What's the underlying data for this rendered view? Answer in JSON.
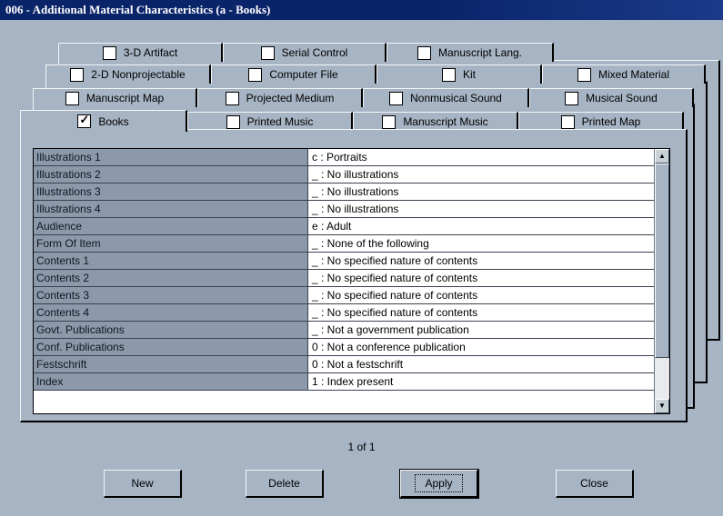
{
  "window": {
    "title": "006 - Additional Material Characteristics (a - Books)"
  },
  "tabs": {
    "row1": [
      {
        "label": "3-D Artifact",
        "checked": false
      },
      {
        "label": "Serial Control",
        "checked": false
      },
      {
        "label": "Manuscript Lang.",
        "checked": false
      }
    ],
    "row2": [
      {
        "label": "2-D Nonprojectable",
        "checked": false
      },
      {
        "label": "Computer File",
        "checked": false
      },
      {
        "label": "Kit",
        "checked": false
      },
      {
        "label": "Mixed Material",
        "checked": false
      }
    ],
    "row3": [
      {
        "label": "Manuscript Map",
        "checked": false
      },
      {
        "label": "Projected Medium",
        "checked": false
      },
      {
        "label": "Nonmusical Sound",
        "checked": false
      },
      {
        "label": "Musical Sound",
        "checked": false
      }
    ],
    "row4": [
      {
        "label": "Books",
        "checked": true,
        "active": true
      },
      {
        "label": "Printed Music",
        "checked": false
      },
      {
        "label": "Manuscript Music",
        "checked": false
      },
      {
        "label": "Printed Map",
        "checked": false
      }
    ]
  },
  "grid": {
    "rows": [
      {
        "label": "Illustrations 1",
        "value": "c : Portraits"
      },
      {
        "label": "Illustrations 2",
        "value": "_ : No illustrations"
      },
      {
        "label": "Illustrations 3",
        "value": "_ : No illustrations"
      },
      {
        "label": "Illustrations 4",
        "value": "_ : No illustrations"
      },
      {
        "label": "Audience",
        "value": "e : Adult"
      },
      {
        "label": "Form Of Item",
        "value": "_ : None of the following"
      },
      {
        "label": "Contents 1",
        "value": "_ : No specified nature of contents"
      },
      {
        "label": "Contents 2",
        "value": "_ : No specified nature of contents"
      },
      {
        "label": "Contents 3",
        "value": "_ : No specified nature of contents"
      },
      {
        "label": "Contents 4",
        "value": "_ : No specified nature of contents"
      },
      {
        "label": "Govt. Publications",
        "value": "_ : Not a government publication"
      },
      {
        "label": "Conf. Publications",
        "value": "0 : Not a conference publication"
      },
      {
        "label": "Festschrift",
        "value": "0 : Not a festschrift"
      },
      {
        "label": "Index",
        "value": "1 : Index present"
      }
    ]
  },
  "pager": {
    "text": "1 of 1"
  },
  "buttons": {
    "new": "New",
    "delete": "Delete",
    "apply": "Apply",
    "close": "Close"
  }
}
